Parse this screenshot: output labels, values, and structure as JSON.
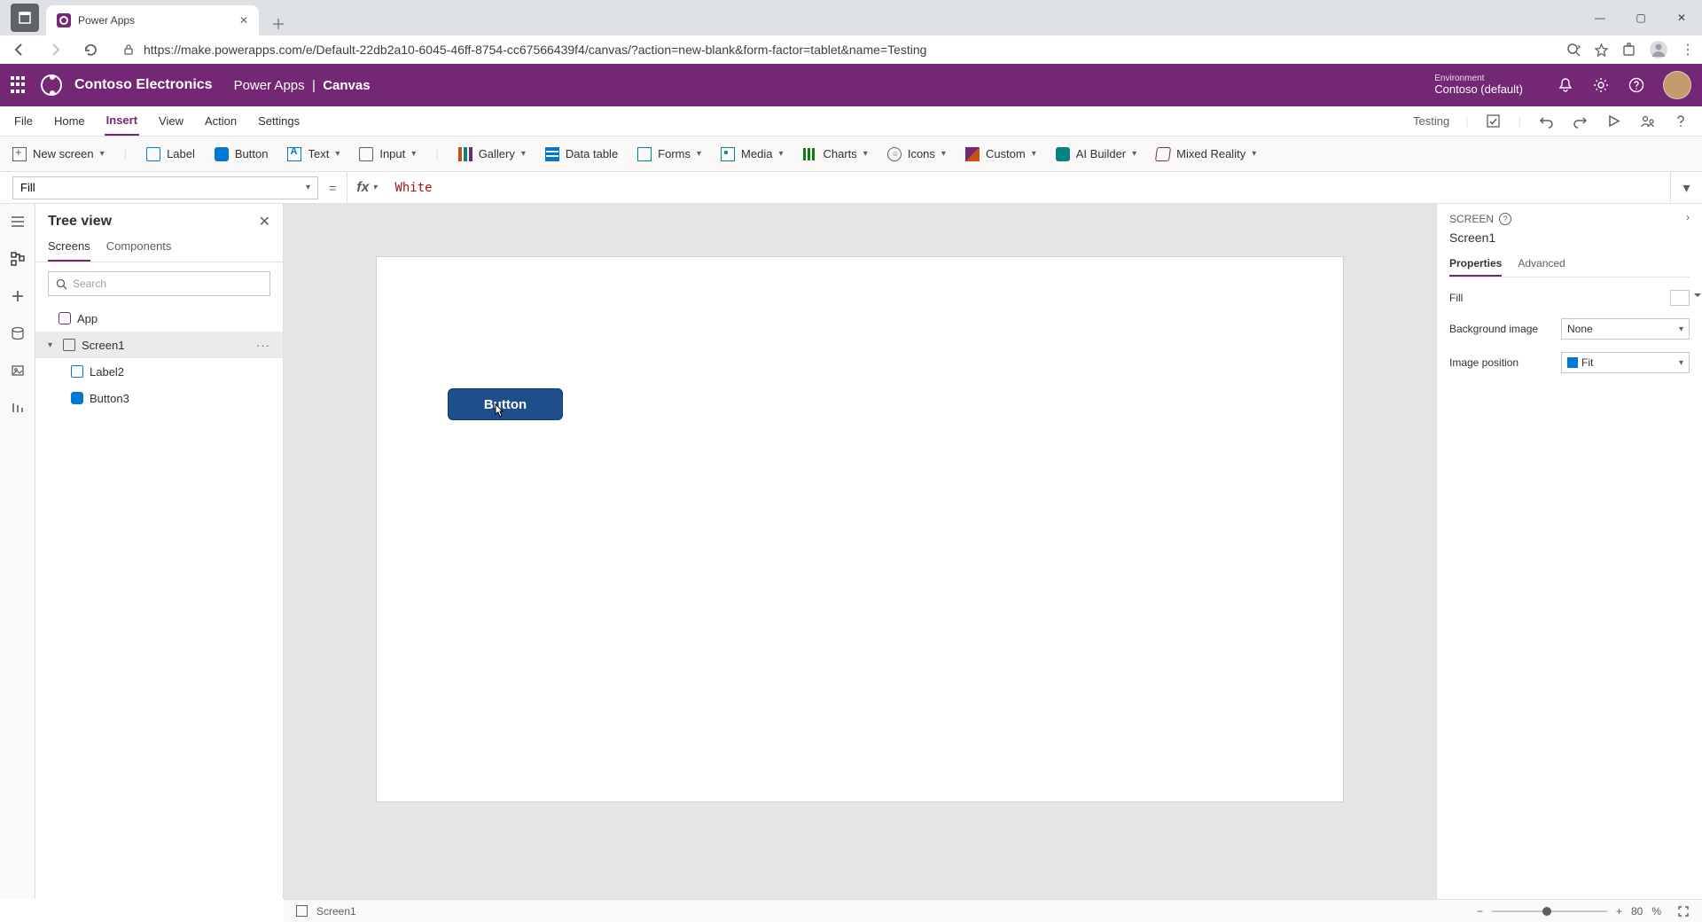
{
  "browser": {
    "tab_title": "Power Apps",
    "url": "https://make.powerapps.com/e/Default-22db2a10-6045-46ff-8754-cc67566439f4/canvas/?action=new-blank&form-factor=tablet&name=Testing"
  },
  "header": {
    "org": "Contoso Electronics",
    "app": "Power Apps",
    "section": "Canvas",
    "env_label": "Environment",
    "env_name": "Contoso (default)"
  },
  "menu": {
    "items": [
      "File",
      "Home",
      "Insert",
      "View",
      "Action",
      "Settings"
    ],
    "active": "Insert",
    "app_name": "Testing"
  },
  "ribbon": {
    "new_screen": "New screen",
    "label": "Label",
    "button": "Button",
    "text": "Text",
    "input": "Input",
    "gallery": "Gallery",
    "data_table": "Data table",
    "forms": "Forms",
    "media": "Media",
    "charts": "Charts",
    "icons": "Icons",
    "custom": "Custom",
    "ai_builder": "AI Builder",
    "mixed_reality": "Mixed Reality"
  },
  "formula": {
    "property": "Fill",
    "fx": "fx",
    "value": "White"
  },
  "tree": {
    "title": "Tree view",
    "tabs": [
      "Screens",
      "Components"
    ],
    "active_tab": "Screens",
    "search_placeholder": "Search",
    "nodes": {
      "app": "App",
      "screen1": "Screen1",
      "label2": "Label2",
      "button3": "Button3"
    }
  },
  "canvas": {
    "button_text": "Button"
  },
  "props": {
    "breadcrumb": "SCREEN",
    "name": "Screen1",
    "tabs": [
      "Properties",
      "Advanced"
    ],
    "active_tab": "Properties",
    "rows": {
      "fill": "Fill",
      "bg_image": "Background image",
      "bg_image_val": "None",
      "img_pos": "Image position",
      "img_pos_val": "Fit"
    }
  },
  "status": {
    "screen": "Screen1",
    "zoom": "80",
    "zoom_unit": "%"
  }
}
